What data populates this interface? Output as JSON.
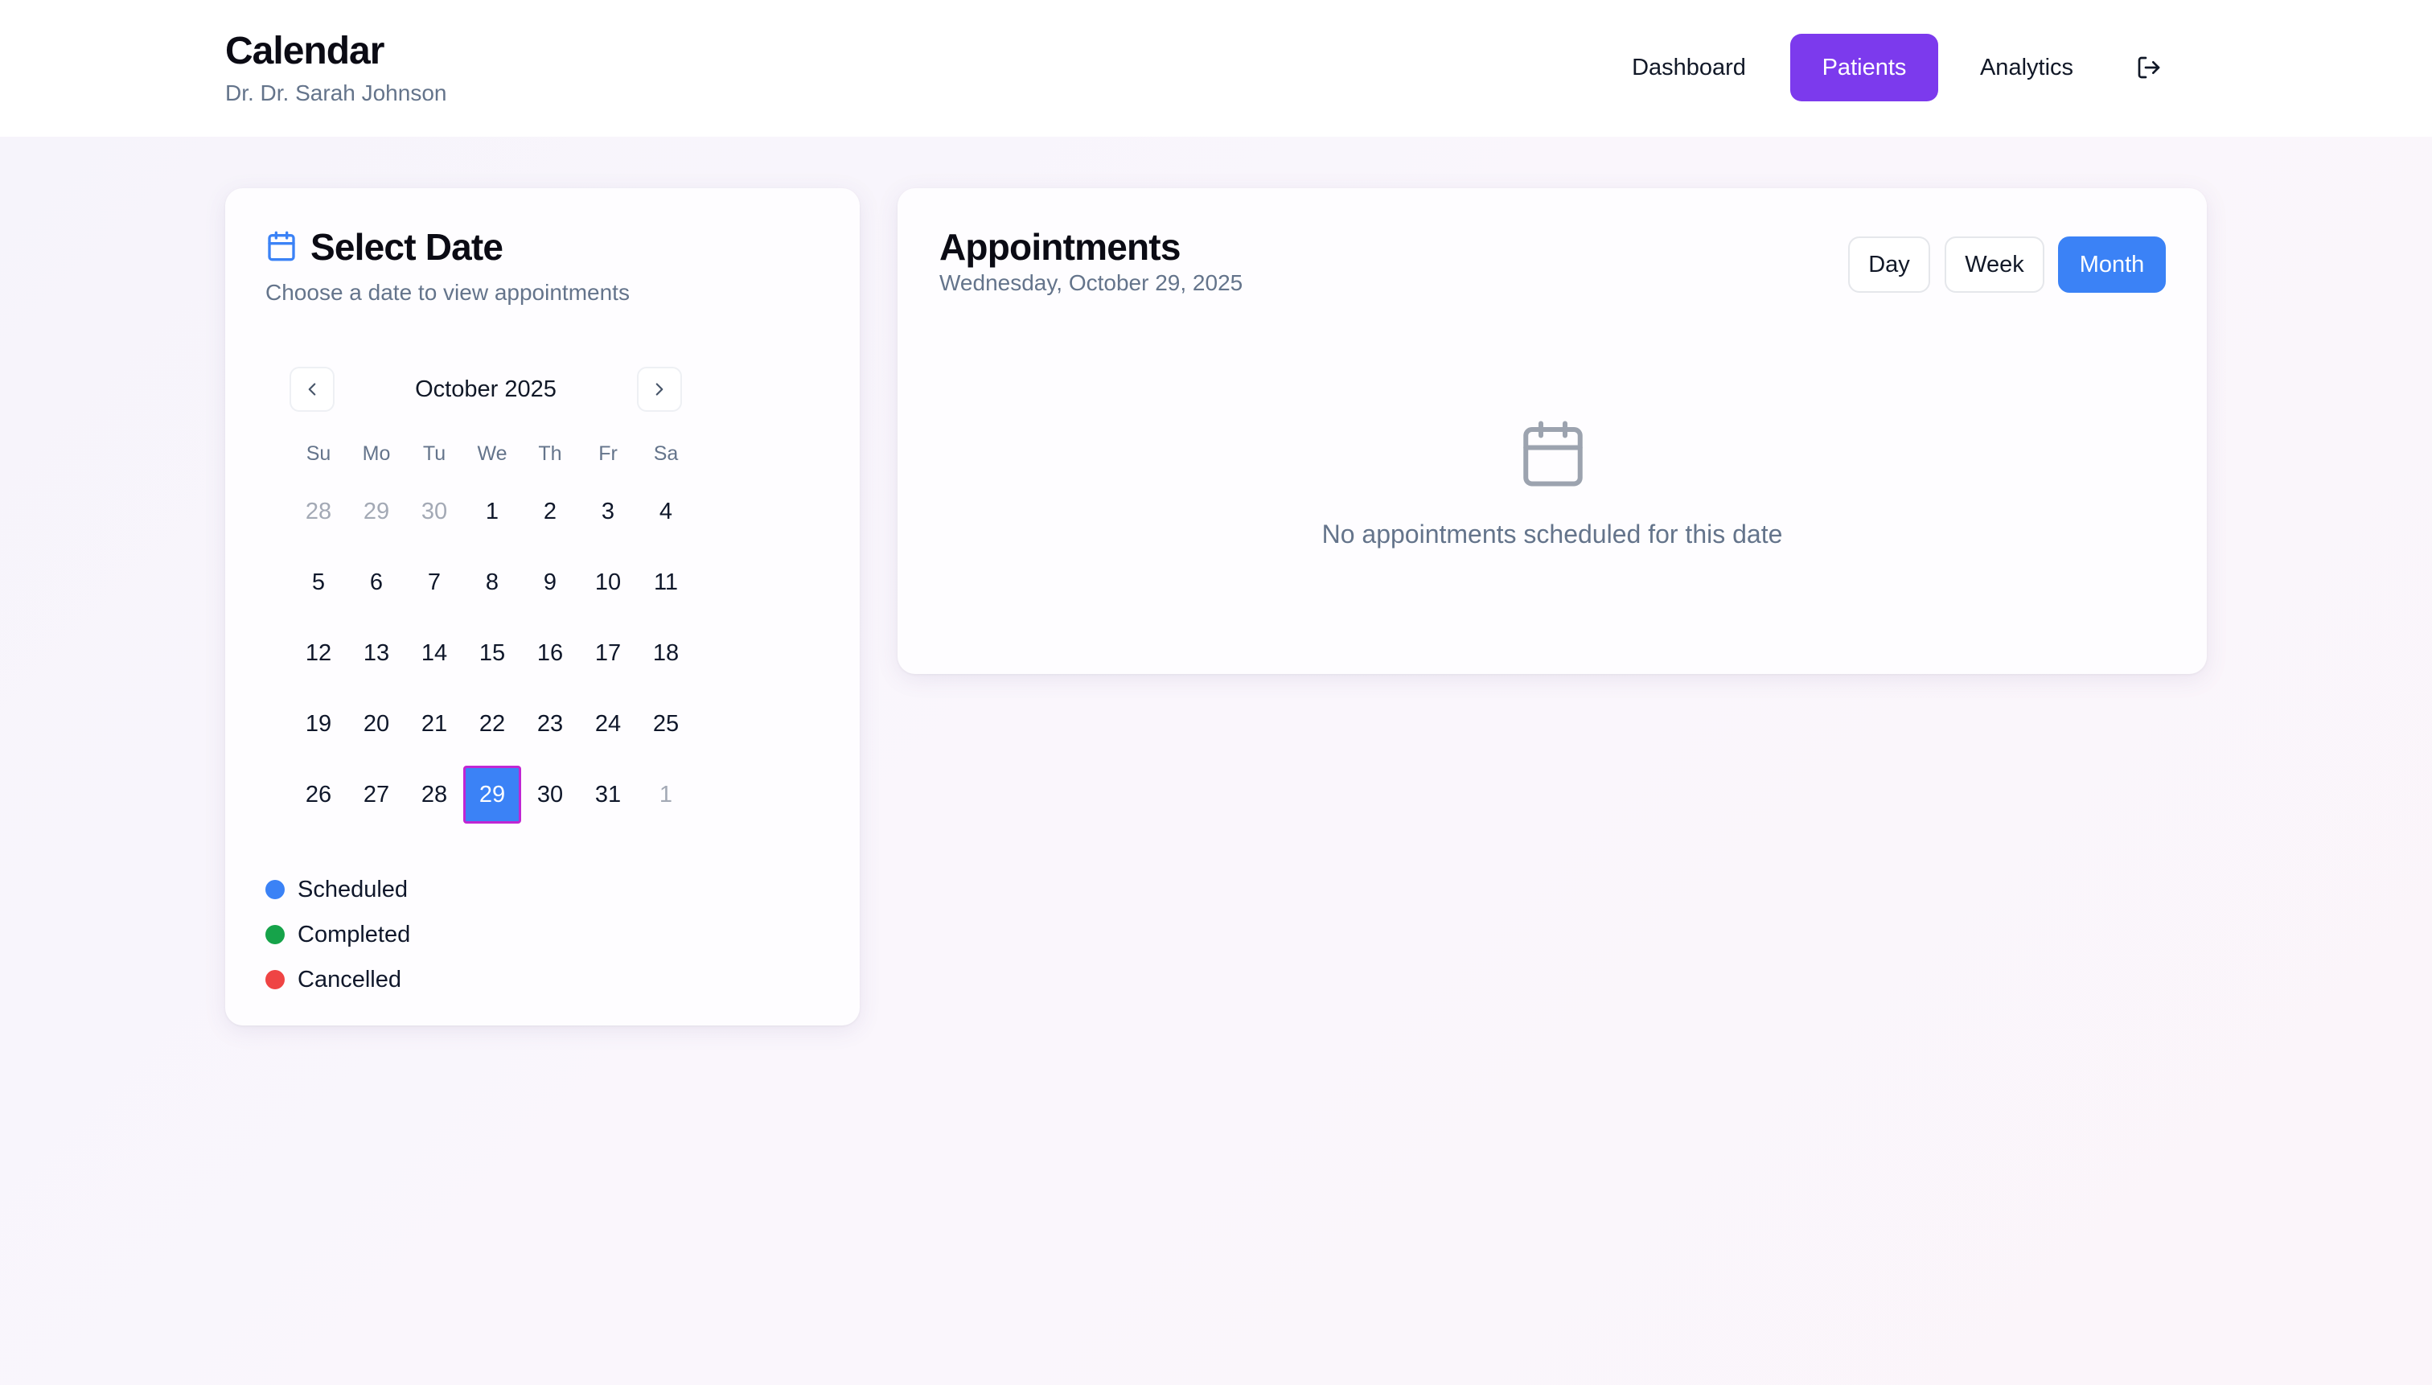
{
  "header": {
    "title": "Calendar",
    "subtitle": "Dr. Dr. Sarah Johnson",
    "nav": {
      "dashboard": "Dashboard",
      "patients": "Patients",
      "analytics": "Analytics",
      "logout_icon": "logout-icon"
    },
    "active_nav": "Patients",
    "accent_color": "#7c3aed"
  },
  "date_panel": {
    "title": "Select Date",
    "subtitle": "Choose a date to view appointments",
    "icon": "calendar-icon",
    "calendar": {
      "month_label": "October 2025",
      "weekdays": [
        "Su",
        "Mo",
        "Tu",
        "We",
        "Th",
        "Fr",
        "Sa"
      ],
      "weeks": [
        [
          {
            "d": "28",
            "muted": true
          },
          {
            "d": "29",
            "muted": true
          },
          {
            "d": "30",
            "muted": true
          },
          {
            "d": "1"
          },
          {
            "d": "2"
          },
          {
            "d": "3"
          },
          {
            "d": "4"
          }
        ],
        [
          {
            "d": "5"
          },
          {
            "d": "6"
          },
          {
            "d": "7"
          },
          {
            "d": "8"
          },
          {
            "d": "9"
          },
          {
            "d": "10"
          },
          {
            "d": "11"
          }
        ],
        [
          {
            "d": "12"
          },
          {
            "d": "13"
          },
          {
            "d": "14"
          },
          {
            "d": "15"
          },
          {
            "d": "16"
          },
          {
            "d": "17"
          },
          {
            "d": "18"
          }
        ],
        [
          {
            "d": "19"
          },
          {
            "d": "20"
          },
          {
            "d": "21"
          },
          {
            "d": "22"
          },
          {
            "d": "23"
          },
          {
            "d": "24"
          },
          {
            "d": "25"
          }
        ],
        [
          {
            "d": "26"
          },
          {
            "d": "27"
          },
          {
            "d": "28"
          },
          {
            "d": "29",
            "selected": true
          },
          {
            "d": "30"
          },
          {
            "d": "31"
          },
          {
            "d": "1",
            "muted": true
          }
        ]
      ],
      "selected_color": "#3b82f6"
    },
    "legend": [
      {
        "label": "Scheduled",
        "color": "#3b82f6"
      },
      {
        "label": "Completed",
        "color": "#16a34a"
      },
      {
        "label": "Cancelled",
        "color": "#ef4444"
      }
    ]
  },
  "appointments": {
    "title": "Appointments",
    "date": "Wednesday, October 29, 2025",
    "views": {
      "day": "Day",
      "week": "Week",
      "month": "Month"
    },
    "active_view": "Month",
    "empty_icon": "calendar-icon",
    "empty_text": "No appointments scheduled for this date"
  }
}
